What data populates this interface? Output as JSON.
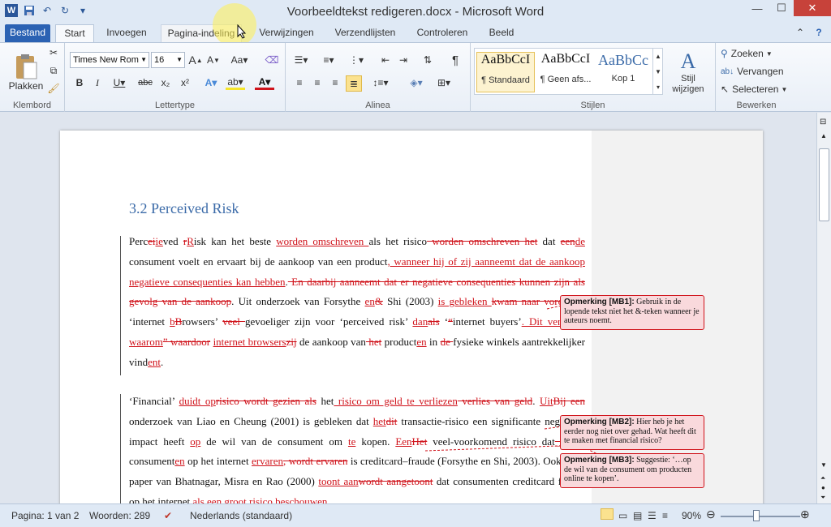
{
  "window": {
    "title": "Voorbeeldtekst redigeren.docx - Microsoft Word",
    "minimize": "—",
    "maximize": "☐",
    "close": "✕"
  },
  "qat": {
    "word_logo": "W",
    "undo": "↶",
    "redo": "↻",
    "more": "▾"
  },
  "tabs": [
    "Bestand",
    "Start",
    "Invoegen",
    "Pagina-indeling",
    "Verwijzingen",
    "Verzendlijsten",
    "Controleren",
    "Beeld"
  ],
  "ribbon": {
    "clipboard": {
      "paste": "Plakken",
      "label": "Klembord"
    },
    "font": {
      "name": "Times New Rom",
      "size": "16",
      "label": "Lettertype"
    },
    "paragraph": {
      "label": "Alinea"
    },
    "styles": {
      "items": [
        {
          "preview": "AaBbCcI",
          "name": "¶ Standaard"
        },
        {
          "preview": "AaBbCcI",
          "name": "¶ Geen afs..."
        },
        {
          "preview": "AaBbCc",
          "name": "Kop 1"
        }
      ],
      "change": "Stijl wijzigen",
      "label": "Stijlen"
    },
    "editing": {
      "find": "Zoeken",
      "replace": "Vervangen",
      "select": "Selecteren",
      "label": "Bewerken"
    }
  },
  "document": {
    "heading": "3.2 Perceived Risk",
    "para1": [
      [
        "n",
        "Perc"
      ],
      [
        "d",
        "ei"
      ],
      [
        "i",
        "ie"
      ],
      [
        "n",
        "ved "
      ],
      [
        "d",
        "r"
      ],
      [
        "i",
        "R"
      ],
      [
        "n",
        "isk kan het beste "
      ],
      [
        "i",
        "worden omschreven "
      ],
      [
        "n",
        "als het risico"
      ],
      [
        "d",
        " worden omschreven het"
      ],
      [
        "n",
        " dat "
      ],
      [
        "d",
        "een"
      ],
      [
        "i",
        "de"
      ],
      [
        "n",
        " consument voelt en ervaart bij de aankoop van een product"
      ],
      [
        "i",
        ", wanneer hij of zij aanneemt dat de aankoop negatieve consequenties kan hebben"
      ],
      [
        "n",
        "."
      ],
      [
        "d",
        " En daarbij aanneemt dat er negatieve consequenties kunnen zijn als gevolg van de aankoop"
      ],
      [
        "n",
        ". Uit onderzoek van Forsythe "
      ],
      [
        "i",
        "en"
      ],
      [
        "d",
        "&"
      ],
      [
        "n",
        " Shi (2003) "
      ],
      [
        "i",
        "is gebleken "
      ],
      [
        "d",
        "kwam naar voren"
      ],
      [
        "n",
        " dat ‘internet "
      ],
      [
        "i",
        "b"
      ],
      [
        "d",
        "B"
      ],
      [
        "n",
        "rowsers’ "
      ],
      [
        "d",
        "veel "
      ],
      [
        "n",
        "gevoeliger zijn voor ‘perceived risk’ "
      ],
      [
        "i",
        "dan"
      ],
      [
        "d",
        "als"
      ],
      [
        "n",
        " ‘"
      ],
      [
        "d",
        "“"
      ],
      [
        "n",
        "internet buyers’"
      ],
      [
        "i",
        ". Dit verklaart waarom"
      ],
      [
        "d",
        "” waardoor"
      ],
      [
        "n",
        " "
      ],
      [
        "i",
        "internet browsers"
      ],
      [
        "d",
        "zij"
      ],
      [
        "n",
        " de aankoop van"
      ],
      [
        "d",
        " het"
      ],
      [
        "n",
        " product"
      ],
      [
        "i",
        "en"
      ],
      [
        "n",
        " in "
      ],
      [
        "d",
        "de "
      ],
      [
        "n",
        "fysieke winkels aantrekkelijker vind"
      ],
      [
        "i",
        "ent"
      ],
      [
        "n",
        "."
      ]
    ],
    "para2": [
      [
        "n",
        "‘Financial’ "
      ],
      [
        "i",
        "duidt op"
      ],
      [
        "d",
        "risico wordt gezien als"
      ],
      [
        "n",
        " het"
      ],
      [
        "i",
        " risico om geld te verliezen"
      ],
      [
        "d",
        " verlies van geld"
      ],
      [
        "n",
        ". "
      ],
      [
        "i",
        "Uit"
      ],
      [
        "d",
        "Bij een "
      ],
      [
        "n",
        "onderzoek van Liao en Cheung (2001) is gebleken dat "
      ],
      [
        "i",
        "het"
      ],
      [
        "d",
        "dit"
      ],
      [
        "n",
        " transactie-risico een significante negatieve impact heeft "
      ],
      [
        "i",
        "op"
      ],
      [
        "n",
        " de wil van de consument om "
      ],
      [
        "i",
        "te"
      ],
      [
        "n",
        " kopen. "
      ],
      [
        "i",
        "Een"
      ],
      [
        "d",
        "Het"
      ],
      [
        "n",
        " veel-voorkomend risico dat"
      ],
      [
        "d",
        "_ door "
      ],
      [
        "n",
        "consument"
      ],
      [
        "i",
        "en"
      ],
      [
        "n",
        " op het internet "
      ],
      [
        "i",
        "ervaren"
      ],
      [
        "d",
        ", wordt ervaren"
      ],
      [
        "n",
        " is creditcard–fraude (Forsythe en Shi, 2003). Ook "
      ],
      [
        "d",
        "in "
      ],
      [
        "n",
        "de paper van Bhatnagar, Misra en Rao (2000) "
      ],
      [
        "i",
        "toont aan"
      ],
      [
        "d",
        "wordt aangetoont"
      ],
      [
        "n",
        " dat consumenten creditcard fraude op het internet "
      ],
      [
        "i",
        "als een groot risico beschouwen"
      ]
    ],
    "comments": [
      {
        "label": "Opmerking [MB1]:",
        "text": " Gebruik in de lopende tekst niet het &-teken wanneer je auteurs noemt."
      },
      {
        "label": "Opmerking [MB2]:",
        "text": " Hier heb je het eerder nog niet over gehad. Wat heeft dit te maken met financial risico?"
      },
      {
        "label": "Opmerking [MB3]:",
        "text": " Suggestie: ‘…op de wil van de consument om producten online te kopen’."
      }
    ]
  },
  "status": {
    "page": "Pagina: 1 van 2",
    "words": "Woorden: 289",
    "language": "Nederlands (standaard)",
    "zoom": "90%",
    "zoom_level": 0.45
  },
  "colors": {
    "accent": "#2b62b3",
    "revision": "#d0131b",
    "heading": "#3a6aa8"
  }
}
